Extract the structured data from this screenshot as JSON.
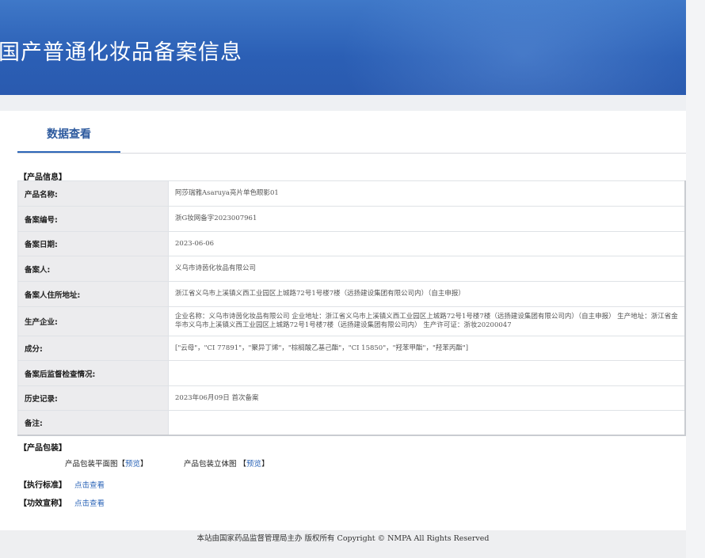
{
  "banner": {
    "title": "国产普通化妆品备案信息"
  },
  "tabs": [
    {
      "label": "数据查看"
    }
  ],
  "product_info": {
    "heading": "【产品信息】",
    "rows": [
      {
        "key": "产品名称:",
        "value": "阿莎瑞雅Asaruya亮片单色眼影01"
      },
      {
        "key": "备案编号:",
        "value": "浙G妆网备字2023007961"
      },
      {
        "key": "备案日期:",
        "value": "2023-06-06"
      },
      {
        "key": "备案人:",
        "value": "义乌市诗茵化妆品有限公司"
      },
      {
        "key": "备案人住所地址:",
        "value": "浙江省义乌市上溪镇义西工业园区上城路72号1号楼7楼（远扬建设集团有限公司内）（自主申报）"
      },
      {
        "key": "生产企业:",
        "value": "企业名称：义乌市诗茵化妆品有限公司 企业地址：浙江省义乌市上溪镇义西工业园区上城路72号1号楼7楼（远扬建设集团有限公司内）（自主申报） 生产地址：浙江省金华市义乌市上溪镇义西工业园区上城路72号1号楼7楼（远扬建设集团有限公司内） 生产许可证：浙妆20200047"
      },
      {
        "key": "成分:",
        "value": "[\"云母\"，\"CI 77891\"，\"聚异丁烯\"，\"棕榈酸乙基己酯\"，\"CI 15850\"，\"羟苯甲酯\"，\"羟苯丙酯\"]"
      },
      {
        "key": "备案后监督检查情况:",
        "value": ""
      },
      {
        "key": "历史记录:",
        "value": "2023年06月09日 首次备案"
      },
      {
        "key": "备注:",
        "value": ""
      }
    ]
  },
  "packaging": {
    "heading": "【产品包装】",
    "flat_label": "产品包装平面图",
    "flat_link": "预览",
    "solid_label": "产品包装立体图",
    "solid_link": "预览"
  },
  "standards": {
    "heading": "【执行标准】",
    "link": "点击查看"
  },
  "claims": {
    "heading": "【功效宣称】",
    "link": "点击查看"
  },
  "footer": {
    "text_cn": "本站由国家药品监督管理局主办 版权所有",
    "text_en": "Copyright © NMPA All Rights Reserved"
  }
}
